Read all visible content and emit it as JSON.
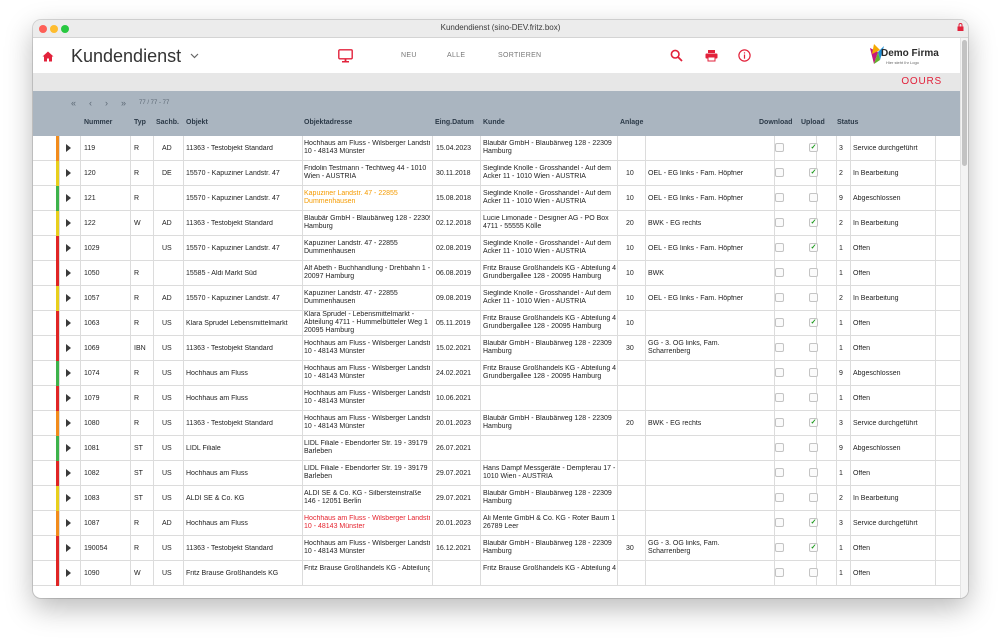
{
  "window": {
    "title": "Kundendienst (sino-DEV.fritz.box)"
  },
  "toolbar": {
    "app_title": "Kundendienst",
    "nav": {
      "neu": "NEU",
      "alle": "ALLE",
      "sortieren": "SORTIEREN"
    },
    "icons": [
      "home-icon",
      "chevron-down-icon",
      "monitor-icon",
      "search-icon",
      "print-icon",
      "info-icon"
    ],
    "accent_color": "#e2223b"
  },
  "logo": {
    "name": "Demo Firma",
    "tagline": "Hier steht Ihr Logo"
  },
  "brand": {
    "text": "OOURS"
  },
  "pager": {
    "first": "«",
    "prev": "‹",
    "next": "›",
    "last": "»",
    "info": "77 / 77 - 77"
  },
  "columns": {
    "nummer": "Nummer",
    "typ": "Typ",
    "sachb": "Sachb.",
    "objekt": "Objekt",
    "objektadresse": "Objektadresse",
    "eing_datum": "Eing.Datum",
    "kunde": "Kunde",
    "anlage": "Anlage",
    "download": "Download",
    "upload": "Upload",
    "status": "Status"
  },
  "status_colors": {
    "orange": "#f28c1c",
    "yellow": "#e8cf1e",
    "green": "#3db24a",
    "red": "#e02525"
  },
  "rows": [
    {
      "stripe": "#f28c1c",
      "nummer": "119",
      "typ": "R",
      "sachb": "AD",
      "objekt": "11363 - Testobjekt Standard",
      "adresse": [
        "Hochhaus am Fluss - Wilsberger Landstr.",
        "10 - 48143 Münster"
      ],
      "adresse_color": "",
      "datum": "15.04.2023",
      "kunde": [
        "Blaubär GmbH - Blaubärweg 128 - 22309",
        "Hamburg"
      ],
      "anlage_nr": "",
      "anlage": [],
      "download": "",
      "upload": "✓",
      "status_nr": "3",
      "status": "Service durchgeführt"
    },
    {
      "stripe": "#e8cf1e",
      "nummer": "120",
      "typ": "R",
      "sachb": "DE",
      "objekt": "15570 - Kapuziner Landstr. 47",
      "adresse": [
        "Fridolin Testmann - Techtweg 44 - 1010",
        "Wien - AUSTRIA"
      ],
      "adresse_color": "",
      "datum": "30.11.2018",
      "kunde": [
        "Sieglinde Knolle - Grosshandel - Auf dem",
        "Acker 11 - 1010 Wien - AUSTRIA"
      ],
      "anlage_nr": "10",
      "anlage": [
        "OEL - EG links - Fam. Höpfner"
      ],
      "download": "",
      "upload": "✓",
      "status_nr": "2",
      "status": "In Bearbeitung"
    },
    {
      "stripe": "#3db24a",
      "nummer": "121",
      "typ": "R",
      "sachb": "",
      "objekt": "15570 - Kapuziner Landstr. 47",
      "adresse": [
        "Kapuziner Landstr. 47 - 22855",
        "Dummenhausen"
      ],
      "adresse_color": "orange",
      "datum": "15.08.2018",
      "kunde": [
        "Sieglinde Knolle - Grosshandel - Auf dem",
        "Acker 11 - 1010 Wien - AUSTRIA"
      ],
      "anlage_nr": "10",
      "anlage": [
        "OEL - EG links - Fam. Höpfner"
      ],
      "download": "",
      "upload": "",
      "status_nr": "9",
      "status": "Abgeschlossen"
    },
    {
      "stripe": "#e8cf1e",
      "nummer": "122",
      "typ": "W",
      "sachb": "AD",
      "objekt": "11363 - Testobjekt Standard",
      "adresse": [
        "Blaubär GmbH - Blaubärweg 128 - 22309",
        "Hamburg"
      ],
      "adresse_color": "",
      "datum": "02.12.2018",
      "kunde": [
        "Lucie Limonade - Designer AG - PO Box",
        "4711 - 55555 Kölle"
      ],
      "anlage_nr": "20",
      "anlage": [
        "BWK - EG rechts"
      ],
      "download": "",
      "upload": "✓",
      "status_nr": "2",
      "status": "In Bearbeitung"
    },
    {
      "stripe": "#e02525",
      "nummer": "1029",
      "typ": "",
      "sachb": "US",
      "objekt": "15570 - Kapuziner Landstr. 47",
      "adresse": [
        "Kapuziner Landstr. 47 - 22855",
        "Dummenhausen"
      ],
      "adresse_color": "",
      "datum": "02.08.2019",
      "kunde": [
        "Sieglinde Knolle - Grosshandel - Auf dem",
        "Acker 11 - 1010 Wien - AUSTRIA"
      ],
      "anlage_nr": "10",
      "anlage": [
        "OEL - EG links - Fam. Höpfner"
      ],
      "download": "",
      "upload": "✓",
      "status_nr": "1",
      "status": "Offen"
    },
    {
      "stripe": "#e02525",
      "nummer": "1050",
      "typ": "R",
      "sachb": "",
      "objekt": "15585 - Aldi Markt Süd",
      "adresse": [
        "Alf Abeth - Buchhandlung - Drehbahn 1 -",
        "20097 Hamburg"
      ],
      "adresse_color": "",
      "datum": "06.08.2019",
      "kunde": [
        "Fritz Brause Großhandels KG - Abteilung 4 -",
        "Grundbergallee 128 - 20095 Hamburg"
      ],
      "anlage_nr": "10",
      "anlage": [
        "BWK"
      ],
      "download": "",
      "upload": "",
      "status_nr": "1",
      "status": "Offen"
    },
    {
      "stripe": "#e8cf1e",
      "nummer": "1057",
      "typ": "R",
      "sachb": "AD",
      "objekt": "15570 - Kapuziner Landstr. 47",
      "adresse": [
        "Kapuziner Landstr. 47 - 22855",
        "Dummenhausen"
      ],
      "adresse_color": "",
      "datum": "09.08.2019",
      "kunde": [
        "Sieglinde Knolle - Grosshandel - Auf dem",
        "Acker 11 - 1010 Wien - AUSTRIA"
      ],
      "anlage_nr": "10",
      "anlage": [
        "OEL - EG links - Fam. Höpfner"
      ],
      "download": "",
      "upload": "",
      "status_nr": "2",
      "status": "In Bearbeitung"
    },
    {
      "stripe": "#e02525",
      "nummer": "1063",
      "typ": "R",
      "sachb": "US",
      "objekt": "Klara Sprudel Lebensmittelmarkt",
      "adresse": [
        "Klara Sprudel - Lebensmittelmarkt -",
        "Abteilung 4711 - Hummelbütteler Weg 1 -",
        "20095 Hamburg"
      ],
      "adresse_color": "",
      "datum": "05.11.2019",
      "kunde": [
        "Fritz Brause Großhandels KG - Abteilung 4 -",
        "Grundbergallee 128 - 20095 Hamburg"
      ],
      "anlage_nr": "10",
      "anlage": [],
      "download": "",
      "upload": "✓",
      "status_nr": "1",
      "status": "Offen"
    },
    {
      "stripe": "#e02525",
      "nummer": "1069",
      "typ": "IBN",
      "sachb": "US",
      "objekt": "11363 - Testobjekt Standard",
      "adresse": [
        "Hochhaus am Fluss - Wilsberger Landstr.",
        "10 - 48143 Münster"
      ],
      "adresse_color": "",
      "datum": "15.02.2021",
      "kunde": [
        "Blaubär GmbH - Blaubärweg 128 - 22309",
        "Hamburg"
      ],
      "anlage_nr": "30",
      "anlage": [
        "GG - 3. OG links, Fam.",
        "Scharrenberg"
      ],
      "download": "",
      "upload": "",
      "status_nr": "1",
      "status": "Offen"
    },
    {
      "stripe": "#3db24a",
      "nummer": "1074",
      "typ": "R",
      "sachb": "US",
      "objekt": "Hochhaus am Fluss",
      "adresse": [
        "Hochhaus am Fluss - Wilsberger Landstr.",
        "10 - 48143 Münster"
      ],
      "adresse_color": "",
      "datum": "24.02.2021",
      "kunde": [
        "Fritz Brause Großhandels KG - Abteilung 4 -",
        "Grundbergallee 128 - 20095 Hamburg"
      ],
      "anlage_nr": "",
      "anlage": [],
      "download": "",
      "upload": "",
      "status_nr": "9",
      "status": "Abgeschlossen"
    },
    {
      "stripe": "#e02525",
      "nummer": "1079",
      "typ": "R",
      "sachb": "US",
      "objekt": "Hochhaus am Fluss",
      "adresse": [
        "Hochhaus am Fluss - Wilsberger Landstr.",
        "10 - 48143 Münster"
      ],
      "adresse_color": "",
      "datum": "10.06.2021",
      "kunde": [],
      "anlage_nr": "",
      "anlage": [],
      "download": "",
      "upload": "",
      "status_nr": "1",
      "status": "Offen"
    },
    {
      "stripe": "#f28c1c",
      "nummer": "1080",
      "typ": "R",
      "sachb": "US",
      "objekt": "11363 - Testobjekt Standard",
      "adresse": [
        "Hochhaus am Fluss - Wilsberger Landstr.",
        "10 - 48143 Münster"
      ],
      "adresse_color": "",
      "datum": "20.01.2023",
      "kunde": [
        "Blaubär GmbH - Blaubärweg 128 - 22309",
        "Hamburg"
      ],
      "anlage_nr": "20",
      "anlage": [
        "BWK - EG rechts"
      ],
      "download": "",
      "upload": "✓",
      "status_nr": "3",
      "status": "Service durchgeführt"
    },
    {
      "stripe": "#3db24a",
      "nummer": "1081",
      "typ": "ST",
      "sachb": "US",
      "objekt": "LIDL Filiale",
      "adresse": [
        "LIDL Filiale - Ebendorfer Str. 19 - 39179",
        "Barleben"
      ],
      "adresse_color": "",
      "datum": "26.07.2021",
      "kunde": [],
      "anlage_nr": "",
      "anlage": [],
      "download": "",
      "upload": "",
      "status_nr": "9",
      "status": "Abgeschlossen"
    },
    {
      "stripe": "#e02525",
      "nummer": "1082",
      "typ": "ST",
      "sachb": "US",
      "objekt": "Hochhaus am Fluss",
      "adresse": [
        "LIDL Filiale - Ebendorfer Str. 19 - 39179",
        "Barleben"
      ],
      "adresse_color": "",
      "datum": "29.07.2021",
      "kunde": [
        "Hans Dampf Messgeräte - Dempferau 17 -",
        "1010 Wien - AUSTRIA"
      ],
      "anlage_nr": "",
      "anlage": [],
      "download": "",
      "upload": "",
      "status_nr": "1",
      "status": "Offen"
    },
    {
      "stripe": "#e8cf1e",
      "nummer": "1083",
      "typ": "ST",
      "sachb": "US",
      "objekt": "ALDI SE & Co. KG",
      "adresse": [
        "ALDI SE & Co. KG - Silbersteinstraße",
        "146 - 12051 Berlin"
      ],
      "adresse_color": "",
      "datum": "29.07.2021",
      "kunde": [
        "Blaubär GmbH - Blaubärweg 128 - 22309",
        "Hamburg"
      ],
      "anlage_nr": "",
      "anlage": [],
      "download": "",
      "upload": "",
      "status_nr": "2",
      "status": "In Bearbeitung"
    },
    {
      "stripe": "#f28c1c",
      "nummer": "1087",
      "typ": "R",
      "sachb": "AD",
      "objekt": "Hochhaus am Fluss",
      "adresse": [
        "Hochhaus am Fluss - Wilsberger Landstr.",
        "10 - 48143 Münster"
      ],
      "adresse_color": "red",
      "datum": "20.01.2023",
      "kunde": [
        "Ali Mente GmbH & Co. KG - Roter Baum 1 -",
        "26789 Leer"
      ],
      "anlage_nr": "",
      "anlage": [],
      "download": "",
      "upload": "✓",
      "status_nr": "3",
      "status": "Service durchgeführt"
    },
    {
      "stripe": "#e02525",
      "nummer": "190054",
      "typ": "R",
      "sachb": "US",
      "objekt": "11363 - Testobjekt Standard",
      "adresse": [
        "Hochhaus am Fluss - Wilsberger Landstr.",
        "10 - 48143 Münster"
      ],
      "adresse_color": "",
      "datum": "16.12.2021",
      "kunde": [
        "Blaubär GmbH - Blaubärweg 128 - 22309",
        "Hamburg"
      ],
      "anlage_nr": "30",
      "anlage": [
        "GG - 3. OG links, Fam.",
        "Scharrenberg"
      ],
      "download": "",
      "upload": "✓",
      "status_nr": "1",
      "status": "Offen"
    },
    {
      "stripe": "#e02525",
      "nummer": "1090",
      "typ": "W",
      "sachb": "US",
      "objekt": "Fritz Brause Großhandels KG",
      "adresse": [
        "Fritz Brause Großhandels KG - Abteilung",
        ""
      ],
      "adresse_color": "",
      "datum": "",
      "kunde": [
        "Fritz Brause Großhandels KG - Abteilung 4 -",
        ""
      ],
      "anlage_nr": "",
      "anlage": [],
      "download": "",
      "upload": "",
      "status_nr": "1",
      "status": "Offen"
    }
  ]
}
